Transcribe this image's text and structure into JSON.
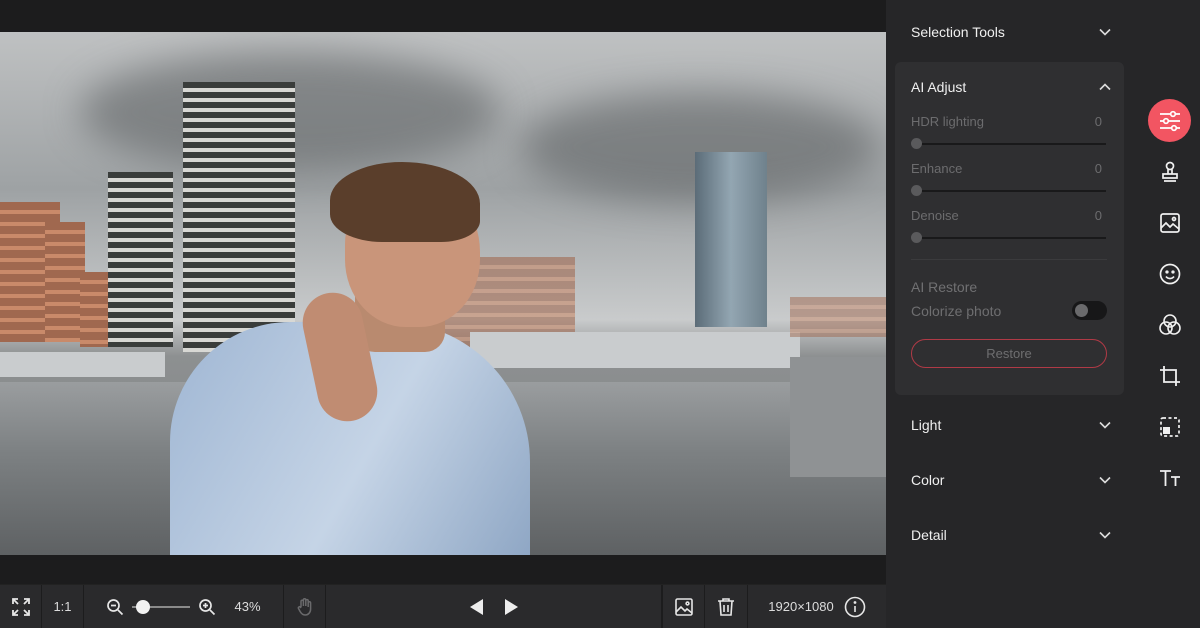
{
  "toolbar": {
    "one_to_one": "1:1",
    "zoom_percent": "43%",
    "zoom_level": 0.08,
    "dimensions": "1920×1080"
  },
  "panel": {
    "selection_tools": "Selection Tools",
    "ai_adjust": {
      "title": "AI Adjust",
      "adjustments": [
        {
          "label": "HDR lighting",
          "value": "0"
        },
        {
          "label": "Enhance",
          "value": "0"
        },
        {
          "label": "Denoise",
          "value": "0"
        }
      ],
      "ai_restore_title": "AI Restore",
      "colorize_label": "Colorize photo",
      "colorize_on": false,
      "restore_button": "Restore"
    },
    "light": "Light",
    "color": "Color",
    "detail": "Detail"
  },
  "icons": {
    "fullscreen": "expand-icon",
    "zoom_out": "zoom-out-icon",
    "zoom_in": "zoom-in-icon",
    "pan": "hand-icon",
    "prev": "previous-icon",
    "next": "next-icon",
    "image": "image-icon",
    "delete": "trash-icon",
    "info": "info-icon",
    "rail": [
      "adjust-sliders-icon",
      "stamp-icon",
      "image-edit-icon",
      "smiley-icon",
      "color-filter-icon",
      "crop-icon",
      "frame-icon",
      "text-icon"
    ]
  },
  "colors": {
    "accent": "#f25562",
    "restore_border": "#b03a46",
    "panel_bg": "#262628",
    "section_bg": "#2f2f31"
  }
}
